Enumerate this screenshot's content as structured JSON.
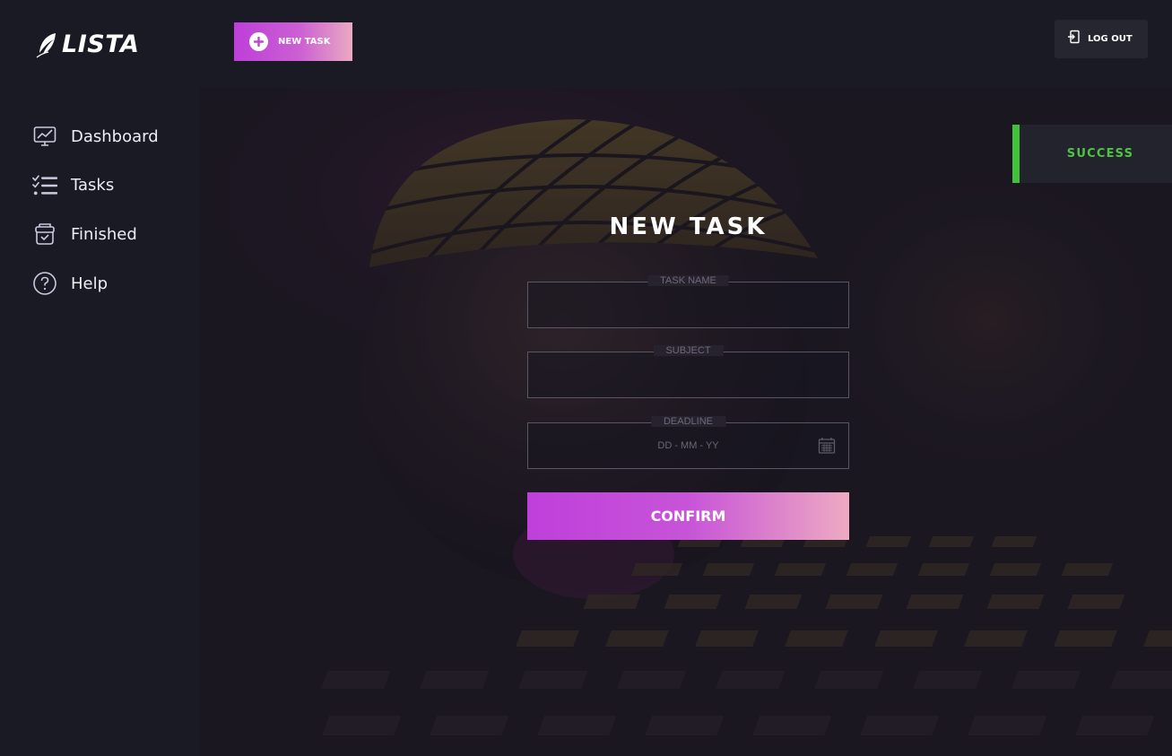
{
  "app": {
    "logo_text": "LISTA"
  },
  "sidebar": {
    "items": [
      {
        "label": "Dashboard",
        "icon": "dashboard-chart-icon"
      },
      {
        "label": "Tasks",
        "icon": "checklist-icon"
      },
      {
        "label": "Finished",
        "icon": "finished-box-icon"
      },
      {
        "label": "Help",
        "icon": "help-circle-icon"
      }
    ]
  },
  "topbar": {
    "new_task_label": "NEW TASK",
    "logout_label": "LOG OUT"
  },
  "toast": {
    "message": "SUCCESS",
    "accent_color": "#42c23b"
  },
  "form": {
    "title": "NEW TASK",
    "fields": {
      "task_name": {
        "label": "TASK NAME",
        "value": ""
      },
      "subject": {
        "label": "SUBJECT",
        "value": ""
      },
      "deadline": {
        "label": "DEADLINE",
        "placeholder": "DD - MM - YY",
        "value": ""
      }
    },
    "confirm_label": "CONFIRM"
  },
  "colors": {
    "background": "#1a1a24",
    "gradient_start": "#bd3fd9",
    "gradient_end": "#eaa9c2",
    "success": "#42c23b"
  }
}
